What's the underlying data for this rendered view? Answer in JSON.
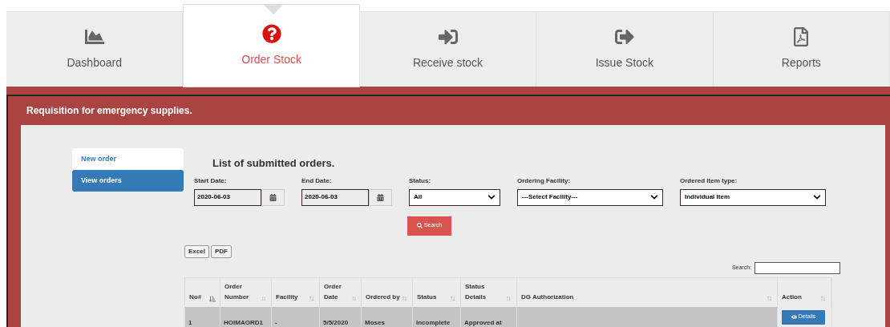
{
  "tabs": [
    {
      "label": "Dashboard",
      "selected": false
    },
    {
      "label": "Order Stock",
      "selected": true
    },
    {
      "label": "Receive stock",
      "selected": false
    },
    {
      "label": "Issue Stock",
      "selected": false
    },
    {
      "label": "Reports",
      "selected": false
    }
  ],
  "panel": {
    "title": "Requisition for emergency supplies."
  },
  "sidebar": {
    "items": [
      {
        "label": "New order",
        "selected": false
      },
      {
        "label": "View orders",
        "selected": true
      }
    ]
  },
  "content": {
    "title": "List of submitted orders.",
    "filters": [
      {
        "kind": "date",
        "label": "Start Date:",
        "value": "2020-06-03"
      },
      {
        "kind": "date",
        "label": "End Date:",
        "value": "2020-06-03"
      },
      {
        "kind": "select",
        "label": "Status:",
        "value": "All"
      },
      {
        "kind": "select",
        "label": "Ordering Facility:",
        "value": "---Select Facility---"
      },
      {
        "kind": "select",
        "label": "Ordered item type:",
        "value": "Individual Item"
      }
    ],
    "search_button": "Search",
    "export_buttons": [
      "Excel",
      "PDF"
    ],
    "table_search": {
      "label": "Search:"
    },
    "table": {
      "columns": [
        {
          "label": "No#",
          "sorted": true
        },
        {
          "label": "Order Number",
          "sorted": false
        },
        {
          "label": "Facility",
          "sorted": false
        },
        {
          "label": "Order Date",
          "sorted": false
        },
        {
          "label": "Ordered by",
          "sorted": false
        },
        {
          "label": "Status",
          "sorted": false
        },
        {
          "label": "Status Details",
          "sorted": false
        },
        {
          "label": "DG Authorization",
          "sorted": false
        },
        {
          "label": "Action",
          "sorted": false
        }
      ],
      "rows": [
        {
          "cells": [
            "1",
            "HOIMAORD1",
            "-",
            "5/5/2020",
            "Moses",
            "Incomplete",
            "Approved at",
            ""
          ],
          "action": "Details"
        }
      ]
    }
  }
}
